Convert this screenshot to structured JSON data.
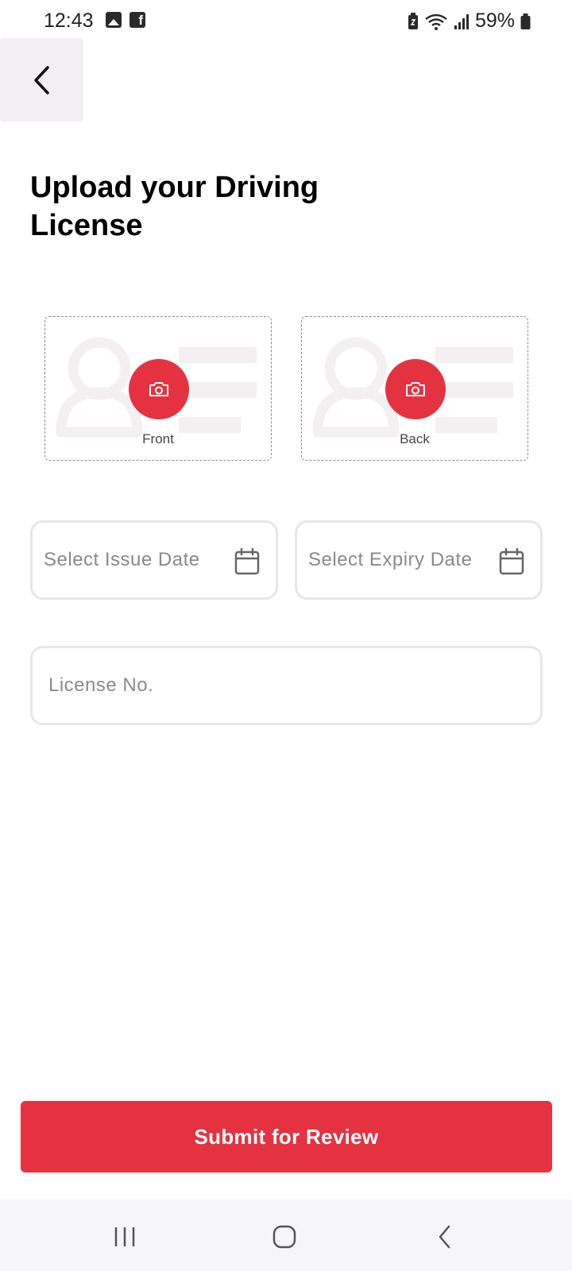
{
  "status_bar": {
    "time": "12:43",
    "battery_text": "59%",
    "left_icons": [
      "gallery-icon",
      "facebook-icon"
    ],
    "right_icons": [
      "battery-saver-icon",
      "wifi-icon",
      "signal-icon",
      "battery-icon"
    ]
  },
  "header": {
    "back_icon": "chevron-left-icon",
    "title": "Upload your Driving License"
  },
  "uploads": {
    "front_label": "Front",
    "back_label": "Back",
    "camera_icon": "camera-icon"
  },
  "form": {
    "issue_date_placeholder": "Select Issue Date",
    "expiry_date_placeholder": "Select Expiry Date",
    "license_placeholder": "License No.",
    "calendar_icon": "calendar-icon"
  },
  "actions": {
    "submit_label": "Submit for Review"
  },
  "nav_bar": {
    "icons": [
      "recents-icon",
      "home-icon",
      "back-icon"
    ]
  },
  "colors": {
    "accent": "#e53240",
    "input_border": "#e7e7e7",
    "back_button_bg": "#f1eff1",
    "nav_bar_bg": "#f6f6fa"
  }
}
